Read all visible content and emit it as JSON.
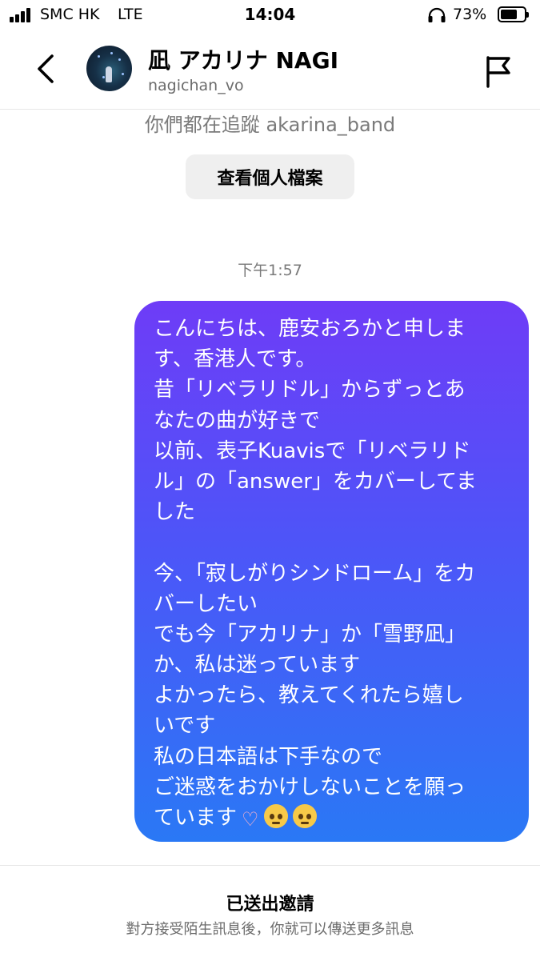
{
  "status_bar": {
    "carrier": "SMC HK",
    "network": "LTE",
    "time": "14:04",
    "battery_percent": "73%",
    "battery_level": 0.73
  },
  "header": {
    "back_icon": "chevron-left-icon",
    "name": "凪 アカリナ NAGI",
    "username": "nagichan_vo",
    "report_icon": "flag-icon"
  },
  "profile_card": {
    "mutual_follow_text": "你們都在追蹤 akarina_band",
    "view_profile_label": "查看個人檔案"
  },
  "conversation": {
    "timestamp": "下午1:57",
    "message_lines": [
      "こんにちは、鹿安おろかと申しま",
      "す、香港人です。",
      "昔「リベラリドル」からずっとあ",
      "なたの曲が好きで",
      "以前、表子Kuavisで「リベラリド",
      "ル」の「answer」をカバーしてま",
      "した",
      "",
      "今、「寂しがりシンドローム」をカ",
      "バーしたい",
      "でも今「アカリナ」か「雪野凪」",
      "か、私は迷っています",
      "よかったら、教えてくれたら嬉し",
      "いです",
      "私の日本語は下手なので",
      "ご迷惑をおかけしないことを願っ",
      "ています"
    ],
    "message_emojis": [
      "heart-hands-emoji",
      "pleading-face-emoji",
      "pleading-face-emoji"
    ],
    "bubble_gradient": [
      "#6e3cf7",
      "#2a78f5"
    ]
  },
  "footer": {
    "title": "已送出邀請",
    "subtitle": "對方接受陌生訊息後，你就可以傳送更多訊息"
  }
}
